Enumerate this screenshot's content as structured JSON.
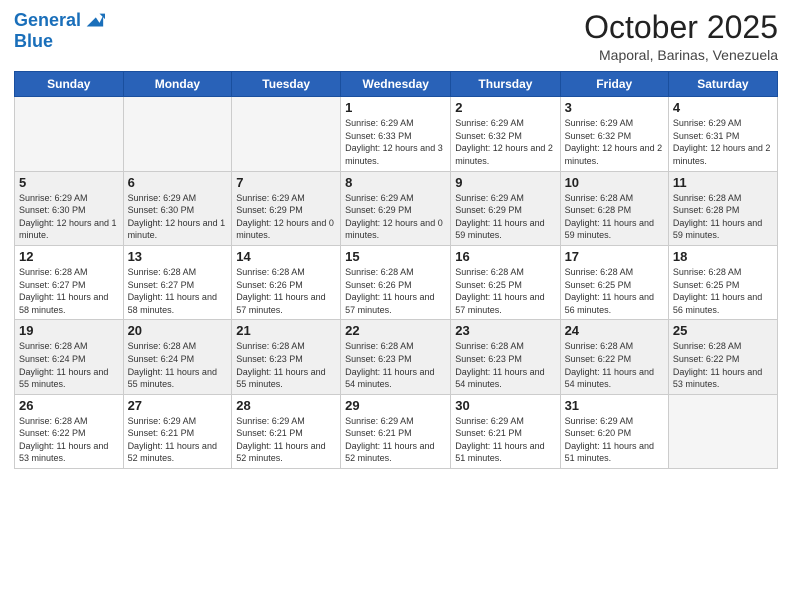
{
  "logo": {
    "line1": "General",
    "line2": "Blue"
  },
  "header": {
    "month": "October 2025",
    "location": "Maporal, Barinas, Venezuela"
  },
  "weekdays": [
    "Sunday",
    "Monday",
    "Tuesday",
    "Wednesday",
    "Thursday",
    "Friday",
    "Saturday"
  ],
  "weeks": [
    [
      {
        "day": "",
        "info": ""
      },
      {
        "day": "",
        "info": ""
      },
      {
        "day": "",
        "info": ""
      },
      {
        "day": "1",
        "info": "Sunrise: 6:29 AM\nSunset: 6:33 PM\nDaylight: 12 hours and 3 minutes."
      },
      {
        "day": "2",
        "info": "Sunrise: 6:29 AM\nSunset: 6:32 PM\nDaylight: 12 hours and 2 minutes."
      },
      {
        "day": "3",
        "info": "Sunrise: 6:29 AM\nSunset: 6:32 PM\nDaylight: 12 hours and 2 minutes."
      },
      {
        "day": "4",
        "info": "Sunrise: 6:29 AM\nSunset: 6:31 PM\nDaylight: 12 hours and 2 minutes."
      }
    ],
    [
      {
        "day": "5",
        "info": "Sunrise: 6:29 AM\nSunset: 6:30 PM\nDaylight: 12 hours and 1 minute."
      },
      {
        "day": "6",
        "info": "Sunrise: 6:29 AM\nSunset: 6:30 PM\nDaylight: 12 hours and 1 minute."
      },
      {
        "day": "7",
        "info": "Sunrise: 6:29 AM\nSunset: 6:29 PM\nDaylight: 12 hours and 0 minutes."
      },
      {
        "day": "8",
        "info": "Sunrise: 6:29 AM\nSunset: 6:29 PM\nDaylight: 12 hours and 0 minutes."
      },
      {
        "day": "9",
        "info": "Sunrise: 6:29 AM\nSunset: 6:29 PM\nDaylight: 11 hours and 59 minutes."
      },
      {
        "day": "10",
        "info": "Sunrise: 6:28 AM\nSunset: 6:28 PM\nDaylight: 11 hours and 59 minutes."
      },
      {
        "day": "11",
        "info": "Sunrise: 6:28 AM\nSunset: 6:28 PM\nDaylight: 11 hours and 59 minutes."
      }
    ],
    [
      {
        "day": "12",
        "info": "Sunrise: 6:28 AM\nSunset: 6:27 PM\nDaylight: 11 hours and 58 minutes."
      },
      {
        "day": "13",
        "info": "Sunrise: 6:28 AM\nSunset: 6:27 PM\nDaylight: 11 hours and 58 minutes."
      },
      {
        "day": "14",
        "info": "Sunrise: 6:28 AM\nSunset: 6:26 PM\nDaylight: 11 hours and 57 minutes."
      },
      {
        "day": "15",
        "info": "Sunrise: 6:28 AM\nSunset: 6:26 PM\nDaylight: 11 hours and 57 minutes."
      },
      {
        "day": "16",
        "info": "Sunrise: 6:28 AM\nSunset: 6:25 PM\nDaylight: 11 hours and 57 minutes."
      },
      {
        "day": "17",
        "info": "Sunrise: 6:28 AM\nSunset: 6:25 PM\nDaylight: 11 hours and 56 minutes."
      },
      {
        "day": "18",
        "info": "Sunrise: 6:28 AM\nSunset: 6:25 PM\nDaylight: 11 hours and 56 minutes."
      }
    ],
    [
      {
        "day": "19",
        "info": "Sunrise: 6:28 AM\nSunset: 6:24 PM\nDaylight: 11 hours and 55 minutes."
      },
      {
        "day": "20",
        "info": "Sunrise: 6:28 AM\nSunset: 6:24 PM\nDaylight: 11 hours and 55 minutes."
      },
      {
        "day": "21",
        "info": "Sunrise: 6:28 AM\nSunset: 6:23 PM\nDaylight: 11 hours and 55 minutes."
      },
      {
        "day": "22",
        "info": "Sunrise: 6:28 AM\nSunset: 6:23 PM\nDaylight: 11 hours and 54 minutes."
      },
      {
        "day": "23",
        "info": "Sunrise: 6:28 AM\nSunset: 6:23 PM\nDaylight: 11 hours and 54 minutes."
      },
      {
        "day": "24",
        "info": "Sunrise: 6:28 AM\nSunset: 6:22 PM\nDaylight: 11 hours and 54 minutes."
      },
      {
        "day": "25",
        "info": "Sunrise: 6:28 AM\nSunset: 6:22 PM\nDaylight: 11 hours and 53 minutes."
      }
    ],
    [
      {
        "day": "26",
        "info": "Sunrise: 6:28 AM\nSunset: 6:22 PM\nDaylight: 11 hours and 53 minutes."
      },
      {
        "day": "27",
        "info": "Sunrise: 6:29 AM\nSunset: 6:21 PM\nDaylight: 11 hours and 52 minutes."
      },
      {
        "day": "28",
        "info": "Sunrise: 6:29 AM\nSunset: 6:21 PM\nDaylight: 11 hours and 52 minutes."
      },
      {
        "day": "29",
        "info": "Sunrise: 6:29 AM\nSunset: 6:21 PM\nDaylight: 11 hours and 52 minutes."
      },
      {
        "day": "30",
        "info": "Sunrise: 6:29 AM\nSunset: 6:21 PM\nDaylight: 11 hours and 51 minutes."
      },
      {
        "day": "31",
        "info": "Sunrise: 6:29 AM\nSunset: 6:20 PM\nDaylight: 11 hours and 51 minutes."
      },
      {
        "day": "",
        "info": ""
      }
    ]
  ]
}
